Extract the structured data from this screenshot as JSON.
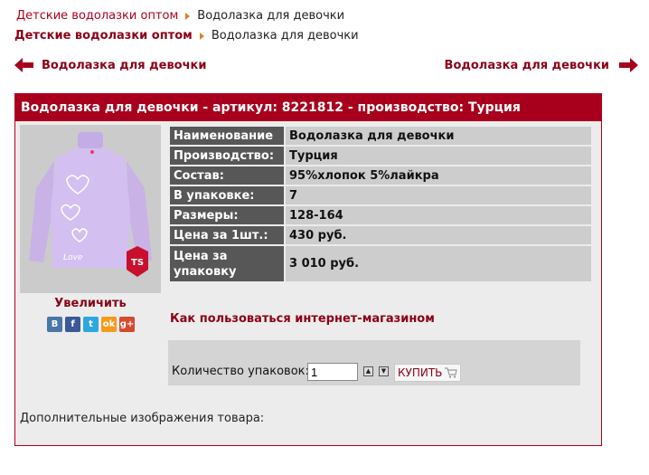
{
  "breadcrumb_top": {
    "link": "Детские водолазки оптом",
    "current": "Водолазка для девочки"
  },
  "breadcrumb_main": {
    "link": "Детские водолазки оптом",
    "current": "Водолазка для девочки"
  },
  "nav": {
    "prev_label": "Водолазка для девочки",
    "next_label": "Водолазка для девочки"
  },
  "product": {
    "heading": "Водолазка для девочки - артикул: 8221812 - производство: Турция",
    "zoom_label": "Увеличить",
    "photo_text": "Love",
    "brand_badge": "TS",
    "specs": [
      {
        "key": "Наименование",
        "value": "Водолазка для девочки"
      },
      {
        "key": "Производство:",
        "value": "Турция"
      },
      {
        "key": "Состав:",
        "value": "95%хлопок 5%лайкра"
      },
      {
        "key": "В упаковке:",
        "value": "7"
      },
      {
        "key": "Размеры:",
        "value": "128-164"
      },
      {
        "key": "Цена за 1шт.:",
        "value": "430 руб."
      },
      {
        "key": "Цена за упаковку",
        "value": "3 010 руб."
      }
    ]
  },
  "social": [
    {
      "icon": "vkontakte-icon",
      "glyph": "В",
      "color": "#4a76a8"
    },
    {
      "icon": "facebook-icon",
      "glyph": "f",
      "color": "#3b5998"
    },
    {
      "icon": "twitter-icon",
      "glyph": "t",
      "color": "#2ca7e0"
    },
    {
      "icon": "odnoklassniki-icon",
      "glyph": "ok",
      "color": "#f59a1b"
    },
    {
      "icon": "google-plus-icon",
      "glyph": "g+",
      "color": "#d6492f"
    }
  ],
  "howto_link": "Как пользоваться интернет-магазином",
  "order": {
    "qty_label": "Количество упаковок:",
    "qty_value": "1",
    "buy_label": "КУПИТЬ"
  },
  "extra_images_label": "Дополнительные изображения товара:",
  "colors": {
    "brand_red": "#a8001c",
    "link_red": "#8b0016",
    "key_cell": "#575757",
    "value_cell": "#cdcdcd"
  }
}
